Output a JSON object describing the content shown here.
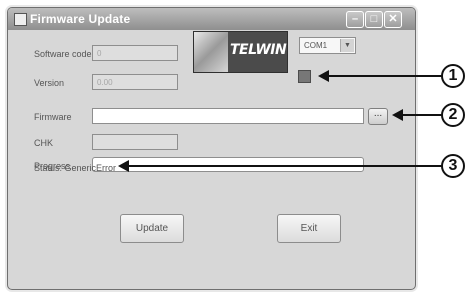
{
  "window": {
    "title": "Firmware Update",
    "buttons": {
      "minimize_icon": "minimize-icon",
      "maximize_icon": "maximize-icon",
      "close_icon": "close-icon"
    }
  },
  "form": {
    "software_code": {
      "label": "Software code",
      "value": "0"
    },
    "version": {
      "label": "Version",
      "value": "0.00"
    },
    "logo_text": "TELWIN",
    "port_select": {
      "value": "COM1"
    },
    "firmware": {
      "label": "Firmware",
      "value": ""
    },
    "browse_label": "...",
    "chk": {
      "label": "CHK",
      "value": ""
    },
    "progress": {
      "label": "Progress",
      "value": 0
    },
    "status_text": "Status: GenericError"
  },
  "actions": {
    "update_label": "Update",
    "exit_label": "Exit"
  },
  "callouts": [
    "1",
    "2",
    "3"
  ],
  "colors": {
    "window_bg": "#d7d7d7",
    "titlebar": "#a3a3a3",
    "callout": "#111111"
  }
}
